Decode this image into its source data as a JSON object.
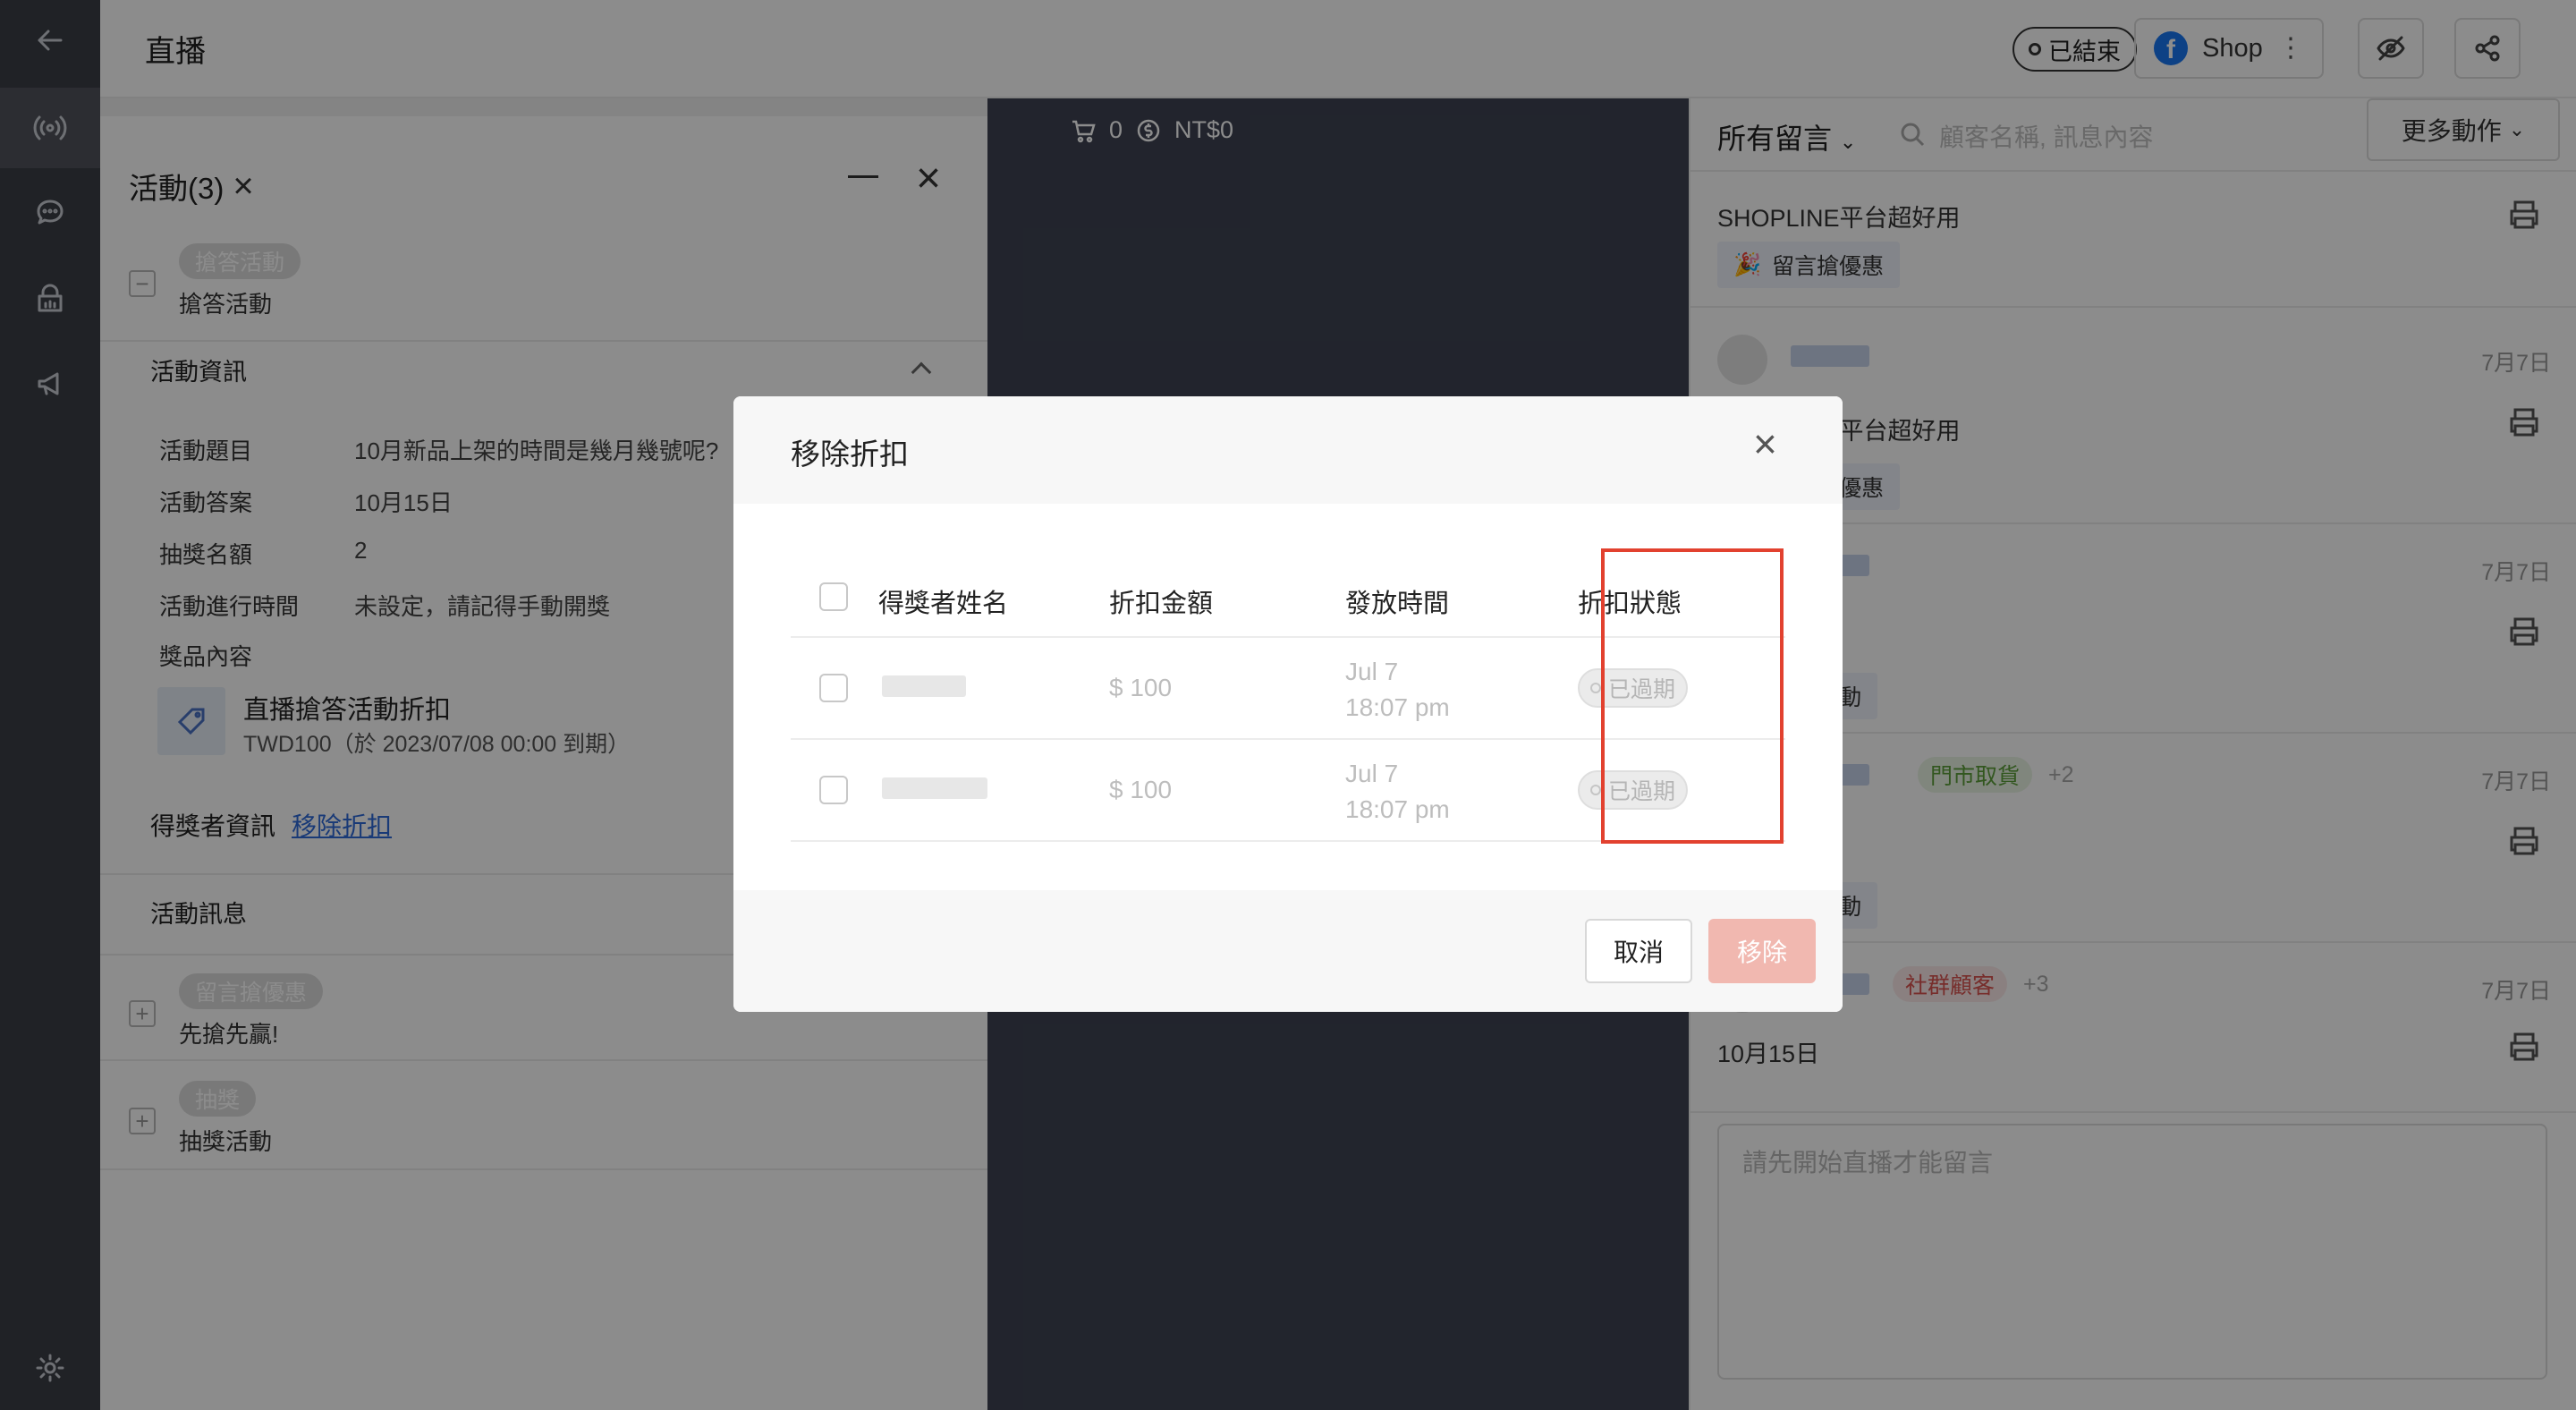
{
  "header": {
    "title": "直播",
    "status_pill": "已結束",
    "shop_label": "Shop",
    "kebab": "⋮"
  },
  "activity_panel": {
    "title": "活動(3)",
    "sections": [
      {
        "tag": "搶答活動",
        "subtitle": "搶答活動"
      }
    ],
    "info_title": "活動資訊",
    "info_rows": [
      {
        "key": "活動題目",
        "value": "10月新品上架的時間是幾月幾號呢?"
      },
      {
        "key": "活動答案",
        "value": "10月15日"
      },
      {
        "key": "抽獎名額",
        "value": "2"
      },
      {
        "key": "活動進行時間",
        "value": "未設定，請記得手動開獎"
      },
      {
        "key": "獎品內容",
        "value": ""
      }
    ],
    "coupon_name": "直播搶答活動折扣",
    "coupon_desc": "TWD100（於 2023/07/08 00:00 到期）",
    "winner_label": "得獎者資訊",
    "winner_link": "移除折扣",
    "messages_title": "活動訊息",
    "extra_sections": [
      {
        "tag": "留言搶優惠",
        "subtitle": "先搶先贏!"
      },
      {
        "tag": "抽獎",
        "subtitle": "抽獎活動"
      }
    ]
  },
  "video": {
    "cart_count": "0",
    "revenue": "NT$0"
  },
  "comments": {
    "filter_label": "所有留言",
    "search_placeholder": "顧客名稱, 訊息內容",
    "more_actions": "更多動作",
    "items": [
      {
        "date": "",
        "text": "SHOPLINE平台超好用",
        "tag": "留言搶優惠"
      },
      {
        "date": "7月7日",
        "text": "SHOPLINE平台超好用",
        "tag": "留言搶優惠"
      },
      {
        "date": "7月7日",
        "text": "",
        "tag": "搶答活動"
      },
      {
        "date": "7月7日",
        "text": "",
        "tag": "搶答活動",
        "badge": "門市取貨",
        "extra": "+2"
      },
      {
        "date": "7月7日",
        "text": "10月15日",
        "tag": "",
        "badge": "社群顧客",
        "extra": "+3"
      }
    ],
    "input_placeholder": "請先開始直播才能留言"
  },
  "modal": {
    "title": "移除折扣",
    "columns": [
      "得獎者姓名",
      "折扣金額",
      "發放時間",
      "折扣狀態"
    ],
    "rows": [
      {
        "amount": "$ 100",
        "date": "Jul 7",
        "time": "18:07 pm",
        "status": "已過期"
      },
      {
        "amount": "$ 100",
        "date": "Jul 7",
        "time": "18:07 pm",
        "status": "已過期"
      }
    ],
    "cancel_label": "取消",
    "remove_label": "移除"
  },
  "icons": {
    "rail": [
      "back-arrow-icon",
      "live-broadcast-icon",
      "chat-icon",
      "shop-icon",
      "megaphone-icon",
      "settings-icon"
    ],
    "header": [
      "facebook-icon",
      "eye-off-icon",
      "share-icon"
    ]
  },
  "colors": {
    "rail_bg": "#3b3e46",
    "video_bg": "#3e4352",
    "link_blue": "#2f6bd9",
    "highlight_red": "#e2412f",
    "remove_button": "#f1b8b0"
  }
}
